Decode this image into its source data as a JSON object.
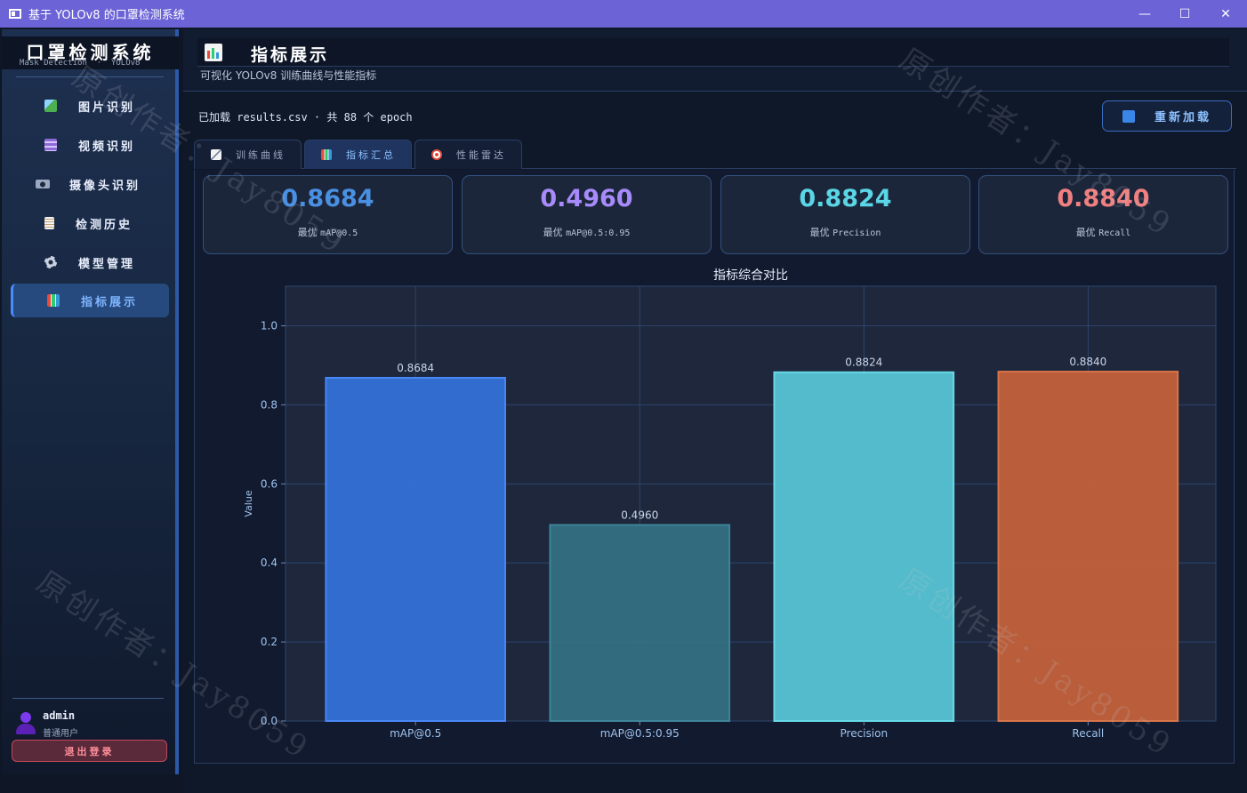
{
  "window": {
    "title": "基于 YOLOv8 的口罩检测系统",
    "controls": {
      "minimize": "—",
      "maximize": "☐",
      "close": "✕"
    }
  },
  "sidebar": {
    "brand_title": "口罩检测系统",
    "brand_subtitle": "Mask Detection  ·  YOLOv8",
    "items": [
      {
        "label": "图片识别",
        "icon": "image-icon",
        "color": "#4caf50"
      },
      {
        "label": "视频识别",
        "icon": "video-icon",
        "color": "#8e6ad6"
      },
      {
        "label": "摄像头识别",
        "icon": "camera-icon",
        "color": "#9aa8c0"
      },
      {
        "label": "检测历史",
        "icon": "history-icon",
        "color": "#f2f2f2"
      },
      {
        "label": "模型管理",
        "icon": "gear-icon",
        "color": "#c9d2e0"
      },
      {
        "label": "指标展示",
        "icon": "bar-chart-icon",
        "color": "#f3f3f3",
        "active": true
      }
    ],
    "user": {
      "name": "admin",
      "role": "普通用户"
    },
    "logout_label": "退出登录"
  },
  "header": {
    "title": "指标展示",
    "subtitle": "可视化 YOLOv8 训练曲线与性能指标"
  },
  "toolbar": {
    "loaded_text": "已加载 results.csv  ·  共 88 个 epoch",
    "reload_label": "重新加载"
  },
  "tabs": [
    {
      "label": "训练曲线",
      "icon": "line-chart-icon",
      "active": false
    },
    {
      "label": "指标汇总",
      "icon": "bar-chart-icon",
      "active": true
    },
    {
      "label": "性能雷达",
      "icon": "target-icon",
      "active": false
    }
  ],
  "cards": [
    {
      "value": "0.8684",
      "label_prefix": "最优 ",
      "label_metric": "mAP@0.5",
      "color": "#4a90e2"
    },
    {
      "value": "0.4960",
      "label_prefix": "最优 ",
      "label_metric": "mAP@0.5:0.95",
      "color": "#a78bfa"
    },
    {
      "value": "0.8824",
      "label_prefix": "最优 ",
      "label_metric": "Precision",
      "color": "#5ad6e6"
    },
    {
      "value": "0.8840",
      "label_prefix": "最优 ",
      "label_metric": "Recall",
      "color": "#f08080"
    }
  ],
  "watermark": "原创作者：Jay8059",
  "chart_data": {
    "type": "bar",
    "title": "指标综合对比",
    "xlabel": "",
    "ylabel": "Value",
    "categories": [
      "mAP@0.5",
      "mAP@0.5:0.95",
      "Precision",
      "Recall"
    ],
    "values": [
      0.8684,
      0.496,
      0.8824,
      0.884
    ],
    "value_labels": [
      "0.8684",
      "0.4960",
      "0.8824",
      "0.8840"
    ],
    "colors": [
      "#3470d6",
      "#356f82",
      "#56c3d3",
      "#c2603a"
    ],
    "edge_colors": [
      "#4a8cff",
      "#3f8a9e",
      "#6be3f0",
      "#e0784a"
    ],
    "ylim": [
      0,
      1.1
    ],
    "yticks": [
      0.0,
      0.2,
      0.4,
      0.6,
      0.8,
      1.0
    ],
    "ytick_labels": [
      "0.0",
      "0.2",
      "0.4",
      "0.6",
      "0.8",
      "1.0"
    ],
    "grid": true
  }
}
